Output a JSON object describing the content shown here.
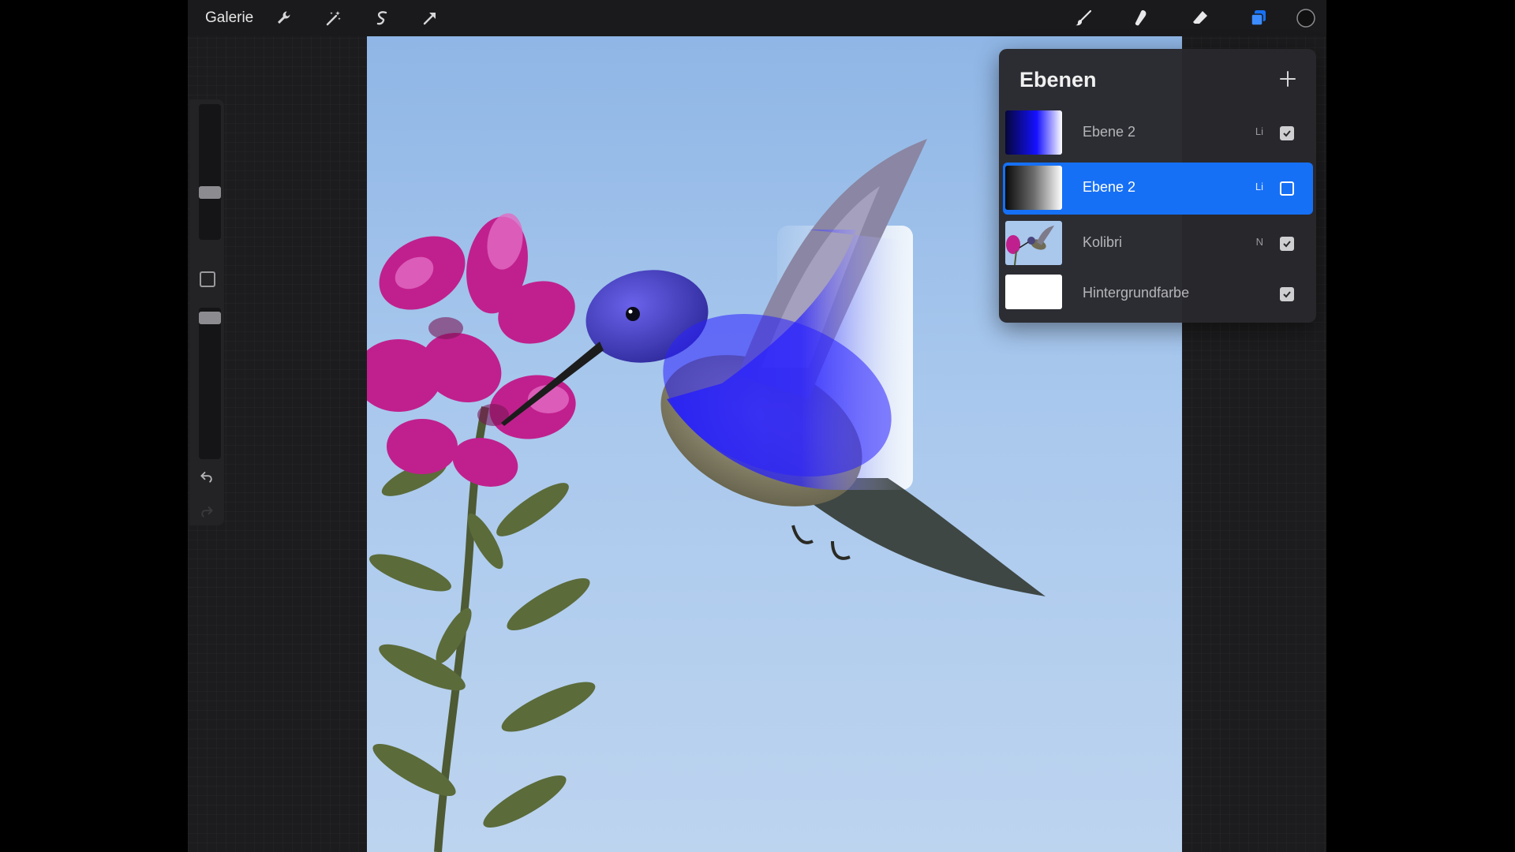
{
  "toolbar": {
    "gallery_label": "Galerie",
    "left_icons": [
      "wrench-icon",
      "magic-wand-icon",
      "selection-icon",
      "transform-arrow-icon"
    ],
    "right_icons": [
      "brush-icon",
      "smudge-icon",
      "eraser-icon",
      "layers-icon",
      "color-swatch-icon"
    ],
    "active_color": "#111111",
    "accent_color": "#1670f5"
  },
  "sidebar": {
    "brush_size_level": 0.65,
    "opacity_level": 0.05
  },
  "layers_panel": {
    "title": "Ebenen",
    "add_label": "+",
    "layers": [
      {
        "name": "Ebene 2",
        "blend": "Li",
        "visible": true,
        "selected": false,
        "thumb": "blue-gradient"
      },
      {
        "name": "Ebene 2",
        "blend": "Li",
        "visible": false,
        "selected": true,
        "thumb": "gray-gradient"
      },
      {
        "name": "Kolibri",
        "blend": "N",
        "visible": true,
        "selected": false,
        "thumb": "photo"
      },
      {
        "name": "Hintergrundfarbe",
        "blend": "",
        "visible": true,
        "selected": false,
        "thumb": "white"
      }
    ]
  }
}
